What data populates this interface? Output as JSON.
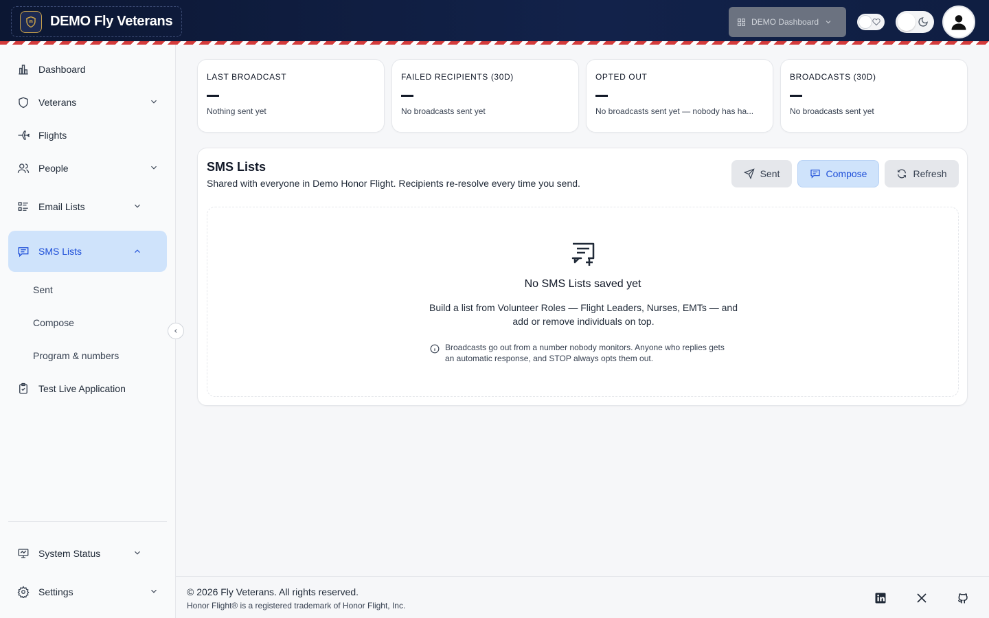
{
  "header": {
    "brand_title": "DEMO Fly Veterans",
    "dashboard_select": "DEMO Dashboard"
  },
  "sidebar": {
    "items": [
      {
        "label": "Dashboard",
        "icon": "bar-chart-icon"
      },
      {
        "label": "Veterans",
        "icon": "shield-icon"
      },
      {
        "label": "Flights",
        "icon": "plane-icon"
      },
      {
        "label": "People",
        "icon": "users-icon"
      },
      {
        "label": "Email Lists",
        "icon": "list-icon"
      },
      {
        "label": "SMS Lists",
        "icon": "message-icon"
      },
      {
        "label": "Test Live Application",
        "icon": "clipboard-check-icon"
      }
    ],
    "sms_sub": [
      "Sent",
      "Compose",
      "Program & numbers"
    ],
    "bottom": [
      {
        "label": "System Status",
        "icon": "monitor-icon"
      },
      {
        "label": "Settings",
        "icon": "gear-icon"
      }
    ]
  },
  "stats": [
    {
      "label": "LAST BROADCAST",
      "value": "—",
      "sub": "Nothing sent yet"
    },
    {
      "label": "FAILED RECIPIENTS (30D)",
      "value": "—",
      "sub": "No broadcasts sent yet"
    },
    {
      "label": "OPTED OUT",
      "value": "—",
      "sub": "No broadcasts sent yet — nobody has ha..."
    },
    {
      "label": "BROADCASTS (30D)",
      "value": "—",
      "sub": "No broadcasts sent yet"
    }
  ],
  "panel": {
    "title": "SMS Lists",
    "subtitle": "Shared with everyone in Demo Honor Flight. Recipients re-resolve every time you send.",
    "buttons": {
      "sent": "Sent",
      "compose": "Compose",
      "refresh": "Refresh"
    },
    "empty_title": "No SMS Lists saved yet",
    "empty_desc": "Build a list from Volunteer Roles — Flight Leaders, Nurses, EMTs — and add or remove individuals on top.",
    "empty_note": "Broadcasts go out from a number nobody monitors. Anyone who replies gets an automatic response, and STOP always opts them out."
  },
  "footer": {
    "copyright": "© 2026 Fly Veterans. All rights reserved.",
    "trademark": "Honor Flight® is a registered trademark of Honor Flight, Inc."
  },
  "colors": {
    "header_bg": "#0c1733",
    "accent": "#1d4ed8",
    "active_bg": "#cfe3fb",
    "stripe_red": "#d43b3b"
  }
}
